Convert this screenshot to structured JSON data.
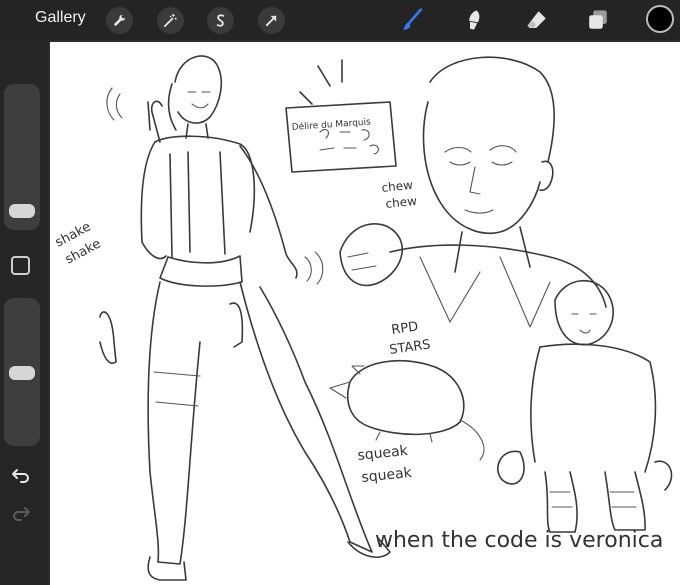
{
  "toolbar": {
    "gallery_label": "Gallery",
    "left_tools": [
      "wrench-icon",
      "magic-wand-icon",
      "selection-icon",
      "transform-arrow-icon"
    ],
    "right_tools": [
      "brush-icon",
      "smudge-icon",
      "eraser-icon",
      "layers-icon"
    ],
    "active_tool": "brush",
    "accent_color": "#2f7cf6",
    "current_color": "#000000"
  },
  "sidebar": {
    "brush_size_level": 0.3,
    "opacity_level": 0.5,
    "controls": [
      "brush-size-slider",
      "modify-button",
      "opacity-slider",
      "undo-icon",
      "redo-icon"
    ]
  },
  "canvas": {
    "annotations": {
      "shake": "shake",
      "shake2": "shake",
      "sign_line1": "Délire du Marquis",
      "chew": "chew",
      "chew2": "chew",
      "rpd": "RPD",
      "stars": "STARS",
      "squeak": "squeak",
      "squeak2": "squeak",
      "caption": "when the code is veronica"
    }
  }
}
